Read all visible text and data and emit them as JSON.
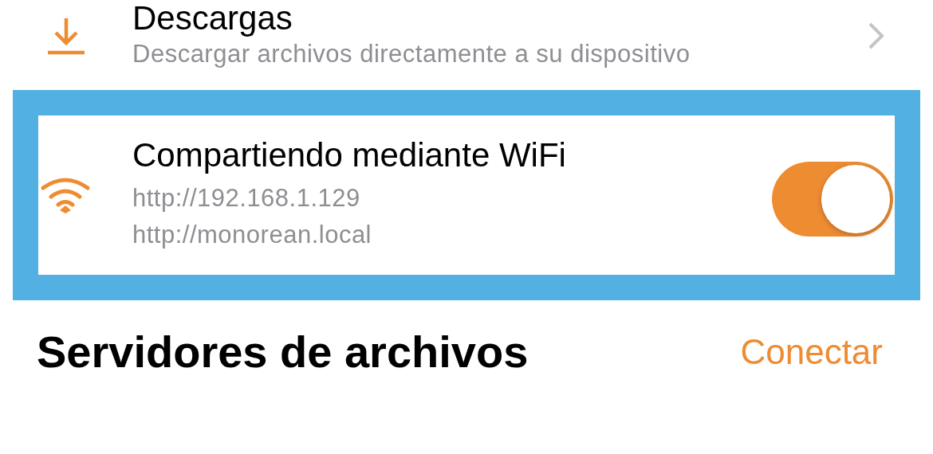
{
  "rows": [
    {
      "kind": "link",
      "title": "Descargas",
      "subtitle": [
        "Descargar archivos directamente a su dispositivo"
      ],
      "highlighted": false
    },
    {
      "kind": "toggle",
      "title": "Compartiendo mediante WiFi",
      "subtitle": [
        "http://192.168.1.129",
        "http://monorean.local"
      ],
      "on": true,
      "highlighted": true
    }
  ],
  "section": {
    "title": "Servidores de archivos",
    "action": "Conectar"
  }
}
